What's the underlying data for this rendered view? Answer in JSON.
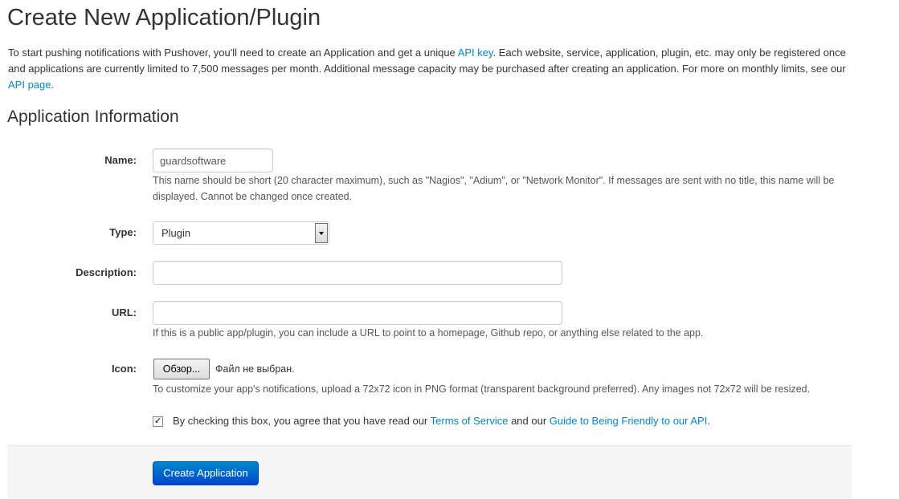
{
  "page": {
    "title": "Create New Application/Plugin"
  },
  "intro": {
    "text_1": "To start pushing notifications with Pushover, you'll need to create an Application and get a unique ",
    "link_api_key": "API key",
    "text_2": ". Each website, service, application, plugin, etc. may only be registered once and applications are currently limited to 7,500 messages per month. Additional message capacity may be purchased after creating an application. For more on monthly limits, see our ",
    "link_api_page": "API page",
    "text_3": "."
  },
  "section": {
    "title": "Application Information"
  },
  "form": {
    "name": {
      "label": "Name:",
      "value": "guardsoftware",
      "help": "This name should be short (20 character maximum), such as \"Nagios\", \"Adium\", or \"Network Monitor\". If messages are sent with no title, this name will be displayed. Cannot be changed once created."
    },
    "type": {
      "label": "Type:",
      "selected": "Plugin"
    },
    "description": {
      "label": "Description:",
      "value": ""
    },
    "url": {
      "label": "URL:",
      "value": "",
      "help": "If this is a public app/plugin, you can include a URL to point to a homepage, Github repo, or anything else related to the app."
    },
    "icon": {
      "label": "Icon:",
      "browse_button": "Обзор...",
      "file_status": "Файл не выбран.",
      "help": "To customize your app's notifications, upload a 72x72 icon in PNG format (transparent background preferred). Any images not 72x72 will be resized."
    },
    "agreement": {
      "checked": true,
      "text_1": "By checking this box, you agree that you have read our ",
      "link_terms": "Terms of Service",
      "text_2": " and our ",
      "link_guide": "Guide to Being Friendly to our API",
      "text_3": "."
    },
    "submit_label": "Create Application"
  },
  "colors": {
    "link": "#0088cc",
    "primary_button": "#0044cc",
    "actions_background": "#f5f5f5"
  }
}
